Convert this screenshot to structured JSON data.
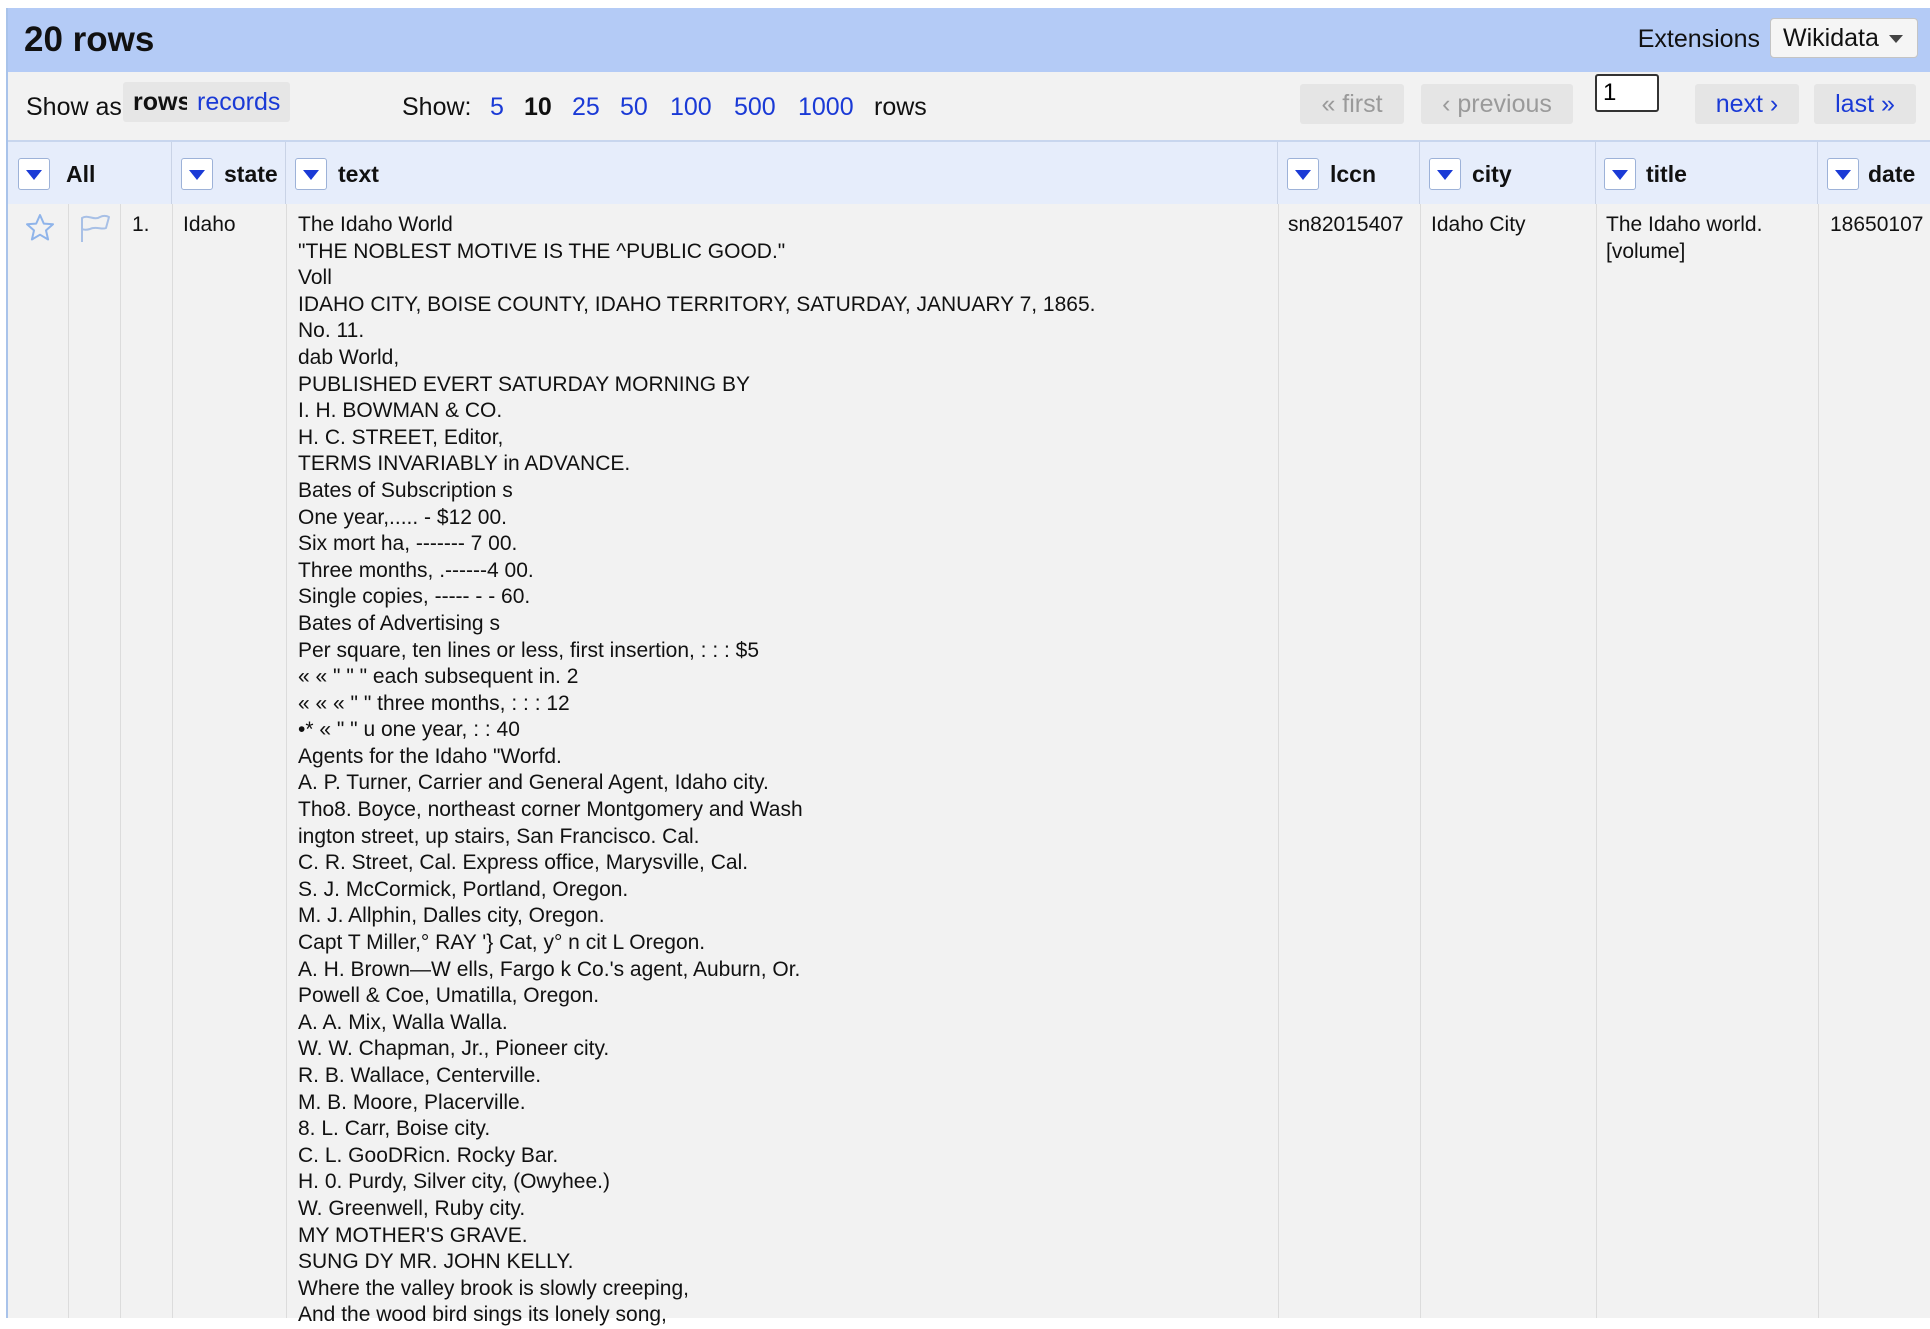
{
  "header": {
    "row_count": "20 rows",
    "extensions_label": "Extensions",
    "wikidata_label": "Wikidata"
  },
  "toolbar": {
    "show_as_label": "Show as:",
    "rows_label": "rows",
    "records_label": "records",
    "show_label": "Show:",
    "page_sizes": [
      "5",
      "10",
      "25",
      "50",
      "100",
      "500",
      "1000"
    ],
    "selected_page_size": "10",
    "rows_suffix": "rows",
    "first_label": "« first",
    "previous_label": "‹ previous",
    "page_value": "1",
    "next_label": "next ›",
    "last_label": "last »"
  },
  "columns": {
    "all": "All",
    "state": "state",
    "text": "text",
    "lccn": "lccn",
    "city": "city",
    "title": "title",
    "date": "date"
  },
  "rows": [
    {
      "index": "1.",
      "state": "Idaho",
      "text_lines": [
        "The Idaho World",
        "\"THE NOBLEST MOTIVE IS THE ^PUBLIC GOOD.\"",
        "Voll",
        "IDAHO CITY, BOISE COUNTY, IDAHO TERRITORY, SATURDAY, JANUARY 7, 1865.",
        "No. 11.",
        "dab World,",
        "PUBLISHED EVERT SATURDAY MORNING BY",
        "I. H. BOWMAN & CO.",
        "H. C. STREET, Editor,",
        "TERMS INVARIABLY in ADVANCE.",
        "Bates of Subscription s",
        "One year,..... - $12 00.",
        "Six mort ha, ------- 7 00.",
        "Three months, .------4 00.",
        "Single copies, ----- - - 60.",
        "Bates of Advertising s",
        "Per square, ten lines or less, first insertion, : : : $5",
        "« « \" \" \" each subsequent in. 2",
        "« « « \" \" three months, : : : 12",
        "•* « \" \" u one year, : : 40",
        "Agents for the Idaho \"Worfd.",
        "A. P. Turner, Carrier and General Agent, Idaho city.",
        "Tho8. Boyce, northeast corner Montgomery and Wash",
        "ington street, up stairs, San Francisco. Cal.",
        "C. R. Street, Cal. Express office, Marysville, Cal.",
        "S. J. McCormick, Portland, Oregon.",
        "M. J. Allphin, Dalles city, Oregon.",
        "Capt T Miller,° RAY '} Cat, y° n cit L Oregon.",
        "A. H. Brown—W ells, Fargo k Co.'s agent, Auburn, Or.",
        "Powell & Coe, Umatilla, Oregon.",
        "A. A. Mix, Walla Walla.",
        "W. W. Chapman, Jr., Pioneer city.",
        "R. B. Wallace, Centerville.",
        "M. B. Moore, Placerville.",
        "8. L. Carr, Boise city.",
        "C. L. GooDRicn. Rocky Bar.",
        "H. 0. Purdy, Silver city, (Owyhee.)",
        "W. Greenwell, Ruby city.",
        "MY MOTHER'S GRAVE.",
        "SUNG DY MR. JOHN KELLY.",
        "Where the valley brook is slowly creeping,",
        "And the wood bird sings its lonely song,"
      ],
      "lccn": "sn82015407",
      "city": "Idaho City",
      "title_lines": [
        "The Idaho world.",
        "[volume]"
      ],
      "date": "18650107"
    }
  ],
  "colors": {
    "header_bg": "#b4cbf6",
    "link": "#1a3ad6",
    "column_header_bg": "#e6edfb",
    "body_bg": "#f2f2f2"
  },
  "icons": {
    "star": "star-icon",
    "flag": "flag-icon",
    "dropdown": "chevron-down-icon"
  }
}
